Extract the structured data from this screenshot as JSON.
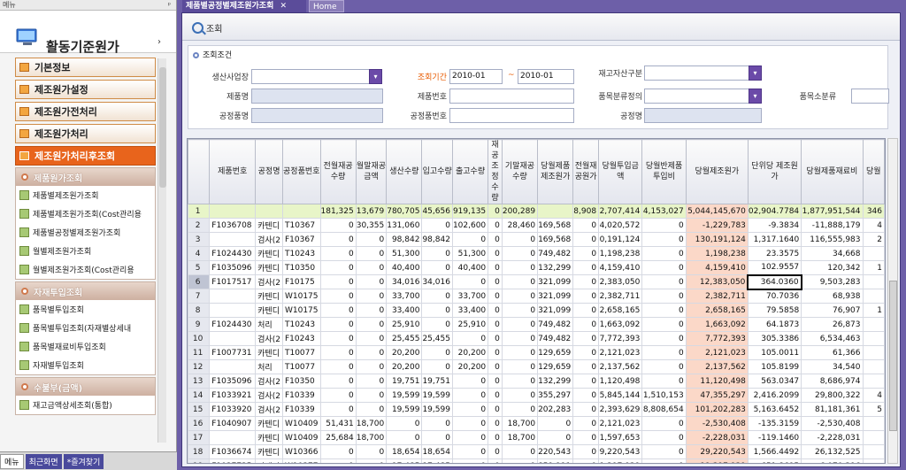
{
  "sidebar": {
    "header": "메뉴",
    "pin": "ᵖ",
    "title": "활동기준원가",
    "expand_arrow": "›",
    "menus": [
      {
        "label": "기본정보",
        "active": false
      },
      {
        "label": "제조원가설정",
        "active": false
      },
      {
        "label": "제조원가전처리",
        "active": false
      },
      {
        "label": "제조원가처리",
        "active": false
      },
      {
        "label": "제조원가처리후조회",
        "active": true
      }
    ],
    "groups": [
      {
        "title": "제품원가조회",
        "items": [
          "제품별제조원가조회",
          "제품별제조원가조회(Cost관리용",
          "제품별공정별제조원가조회",
          "월별제조원가조회",
          "월별제조원가조회(Cost관리용"
        ]
      },
      {
        "title": "자재투입조회",
        "items": [
          "품목별투입조회",
          "품목별투입조회(자재별상세내",
          "품목별재료비투입조회",
          "자재별투입조회"
        ]
      },
      {
        "title": "수불부(금액)",
        "items": [
          "재고금액상세조회(통합)"
        ]
      }
    ],
    "footer_tabs": [
      "메뉴",
      "최근화면",
      "*즐겨찾기"
    ]
  },
  "tabs": [
    {
      "label": "제품별공정별제조원가조회",
      "close": "✕"
    },
    {
      "label": "Home"
    }
  ],
  "toolbar": {
    "search_label": "조회"
  },
  "conditions": {
    "title": "조회조건",
    "site_label": "생산사업장",
    "site_value": "",
    "period_label": "조회기간",
    "period_from": "2010-01",
    "period_tilde": "~",
    "period_to": "2010-01",
    "asset_label": "재고자산구분",
    "asset_value": "",
    "product_name_label": "제품명",
    "product_no_label": "제품번호",
    "item_class_label": "품목분류정의",
    "item_subclass_label": "품목소분류",
    "process_item_label": "공정품명",
    "process_item_no_label": "공정품번호",
    "process_name_label": "공정명",
    "dropdown_arrow": "▾"
  },
  "grid": {
    "headers": [
      "",
      "제품번호",
      "공정명",
      "공정품번호",
      "전월재공수량",
      "월말재공금액",
      "생산수량",
      "입고수량",
      "출고수량",
      "재공조정수량",
      "기말재공수량",
      "당월제품제조원가",
      "전월재공원가",
      "당월투입금액",
      "당월반제품투입비",
      "당월제조원가",
      "단위당 제조원가",
      "당월제품재료비",
      "당월"
    ],
    "rows": [
      {
        "rn": "1",
        "sum": true,
        "c": [
          "",
          "",
          "",
          "181,325",
          "13,679",
          "780,705",
          "45,656",
          "919,135",
          "0",
          "200,289",
          "",
          "8,908",
          "2,707,414",
          "4,153,027",
          "5,044,145,670",
          "02,904.7784",
          "1,877,951,544",
          "346"
        ]
      },
      {
        "rn": "2",
        "c": [
          "F1036708",
          "카텐디",
          "T10367",
          "0",
          "30,355",
          "131,060",
          "0",
          "102,600",
          "0",
          "28,460",
          "169,568",
          "0",
          "4,020,572",
          "0",
          "-1,229,783",
          "-9.3834",
          "-11,888,179",
          "4"
        ]
      },
      {
        "rn": "3",
        "c": [
          "",
          "검사(2",
          "F10367",
          "0",
          "0",
          "98,842",
          "98,842",
          "0",
          "0",
          "0",
          "169,568",
          "0",
          "0,191,124",
          "0",
          "130,191,124",
          "1,317.1640",
          "116,555,983",
          "2"
        ]
      },
      {
        "rn": "4",
        "c": [
          "F1024430",
          "카텐디",
          "T10243",
          "0",
          "0",
          "51,300",
          "0",
          "51,300",
          "0",
          "0",
          "749,482",
          "0",
          "1,198,238",
          "0",
          "1,198,238",
          "23.3575",
          "34,668",
          ""
        ]
      },
      {
        "rn": "5",
        "c": [
          "F1035096",
          "카텐디",
          "T10350",
          "0",
          "0",
          "40,400",
          "0",
          "40,400",
          "0",
          "0",
          "132,299",
          "0",
          "4,159,410",
          "0",
          "4,159,410",
          "102.9557",
          "120,342",
          "1"
        ]
      },
      {
        "rn": "6",
        "sel": true,
        "c": [
          "F1017517",
          "검사(2",
          "F10175",
          "0",
          "0",
          "34,016",
          "34,016",
          "0",
          "0",
          "0",
          "321,099",
          "0",
          "2,383,050",
          "0",
          "12,383,050",
          "364.0360",
          "9,503,283",
          ""
        ]
      },
      {
        "rn": "7",
        "c": [
          "",
          "카텐디",
          "W10175",
          "0",
          "0",
          "33,700",
          "0",
          "33,700",
          "0",
          "0",
          "321,099",
          "0",
          "2,382,711",
          "0",
          "2,382,711",
          "70.7036",
          "68,938",
          ""
        ]
      },
      {
        "rn": "8",
        "c": [
          "",
          "카텐디",
          "W10175",
          "0",
          "0",
          "33,400",
          "0",
          "33,400",
          "0",
          "0",
          "321,099",
          "0",
          "2,658,165",
          "0",
          "2,658,165",
          "79.5858",
          "76,907",
          "1"
        ]
      },
      {
        "rn": "9",
        "c": [
          "F1024430",
          "처리",
          "T10243",
          "0",
          "0",
          "25,910",
          "0",
          "25,910",
          "0",
          "0",
          "749,482",
          "0",
          "1,663,092",
          "0",
          "1,663,092",
          "64.1873",
          "26,873",
          ""
        ]
      },
      {
        "rn": "10",
        "c": [
          "",
          "검사(2",
          "F10243",
          "0",
          "0",
          "25,455",
          "25,455",
          "0",
          "0",
          "0",
          "749,482",
          "0",
          "7,772,393",
          "0",
          "7,772,393",
          "305.3386",
          "6,534,463",
          ""
        ]
      },
      {
        "rn": "11",
        "c": [
          "F1007731",
          "카텐디",
          "T10077",
          "0",
          "0",
          "20,200",
          "0",
          "20,200",
          "0",
          "0",
          "129,659",
          "0",
          "2,121,023",
          "0",
          "2,121,023",
          "105.0011",
          "61,366",
          ""
        ]
      },
      {
        "rn": "12",
        "c": [
          "",
          "처리",
          "T10077",
          "0",
          "0",
          "20,200",
          "0",
          "20,200",
          "0",
          "0",
          "129,659",
          "0",
          "2,137,562",
          "0",
          "2,137,562",
          "105.8199",
          "34,540",
          ""
        ]
      },
      {
        "rn": "13",
        "c": [
          "F1035096",
          "검사(2",
          "F10350",
          "0",
          "0",
          "19,751",
          "19,751",
          "0",
          "0",
          "0",
          "132,299",
          "0",
          "1,120,498",
          "0",
          "11,120,498",
          "563.0347",
          "8,686,974",
          ""
        ]
      },
      {
        "rn": "14",
        "c": [
          "F1033921",
          "검사(2",
          "F10339",
          "0",
          "0",
          "19,599",
          "19,599",
          "0",
          "0",
          "0",
          "355,297",
          "0",
          "5,845,144",
          "1,510,153",
          "47,355,297",
          "2,416.2099",
          "29,800,322",
          "4"
        ]
      },
      {
        "rn": "15",
        "c": [
          "F1033920",
          "검사(2",
          "F10339",
          "0",
          "0",
          "19,599",
          "19,599",
          "0",
          "0",
          "0",
          "202,283",
          "0",
          "2,393,629",
          "8,808,654",
          "101,202,283",
          "5,163.6452",
          "81,181,361",
          "5"
        ]
      },
      {
        "rn": "16",
        "c": [
          "F1040907",
          "카텐디",
          "W10409",
          "51,431",
          "18,700",
          "0",
          "0",
          "0",
          "0",
          "18,700",
          "0",
          "0",
          "2,121,023",
          "0",
          "-2,530,408",
          "-135.3159",
          "-2,530,408",
          ""
        ]
      },
      {
        "rn": "17",
        "c": [
          "",
          "카텐디",
          "W10409",
          "25,684",
          "18,700",
          "0",
          "0",
          "0",
          "0",
          "18,700",
          "0",
          "0",
          "1,597,653",
          "0",
          "-2,228,031",
          "-119.1460",
          "-2,228,031",
          ""
        ]
      },
      {
        "rn": "18",
        "c": [
          "F1036674",
          "카텐디",
          "W10366",
          "0",
          "0",
          "18,654",
          "18,654",
          "0",
          "0",
          "0",
          "220,543",
          "0",
          "9,220,543",
          "0",
          "29,220,543",
          "1,566.4492",
          "26,132,525",
          ""
        ]
      },
      {
        "rn": "19",
        "c": [
          "F1037725",
          "카텐디",
          "W10377",
          "0",
          "0",
          "17,485",
          "17,485",
          "0",
          "0",
          "0",
          "859,111",
          "0",
          "1,397,939",
          "0",
          "11,397,939",
          "651.8695",
          "6,070,396",
          ""
        ]
      }
    ]
  }
}
